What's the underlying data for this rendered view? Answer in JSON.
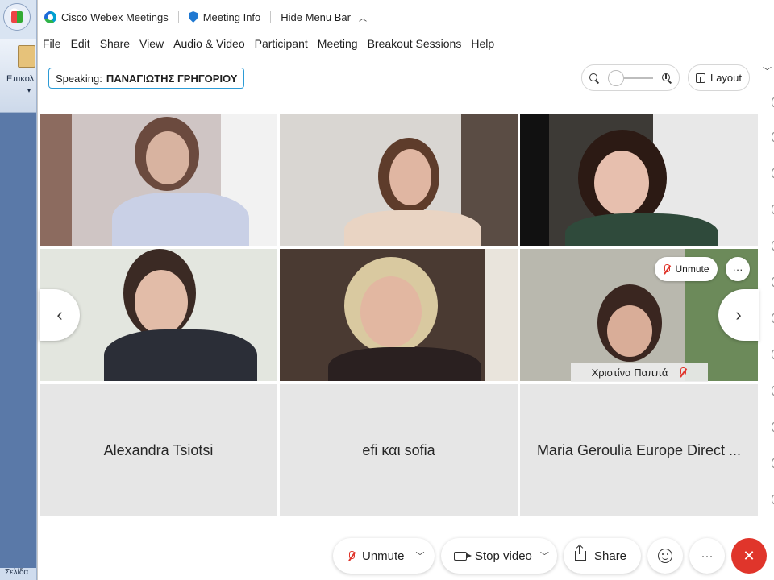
{
  "background_app": {
    "ribbon_label": "Επικολ",
    "status_text": "Σελίδα"
  },
  "titlebar": {
    "app_name": "Cisco Webex Meetings",
    "meeting_info": "Meeting Info",
    "hide_menu_bar": "Hide Menu Bar"
  },
  "menu": [
    "File",
    "Edit",
    "Share",
    "View",
    "Audio & Video",
    "Participant",
    "Meeting",
    "Breakout Sessions",
    "Help"
  ],
  "speaking": {
    "label": "Speaking:",
    "name": "ΠΑΝΑΓΙΩΤΗΣ ΓΡΗΓΟΡΙΟΥ"
  },
  "zoom": {
    "level": 0.1
  },
  "layout_button": {
    "label": "Layout"
  },
  "video_tiles": {
    "tile_unmute_label": "Unmute",
    "tile_more_label": "···",
    "muted_participant_name": "Χριστίνα Παππά"
  },
  "name_tiles": [
    "Alexandra Tsiotsi",
    "efi και sofia",
    "Maria Geroulia Europe Direct ..."
  ],
  "controls": {
    "unmute": "Unmute",
    "stop_video": "Stop video",
    "share": "Share",
    "more": "···",
    "leave_icon": "✕"
  },
  "colors": {
    "accent": "#2c9bd6",
    "leave_red": "#e0352b",
    "muted_red": "#e0352b"
  }
}
